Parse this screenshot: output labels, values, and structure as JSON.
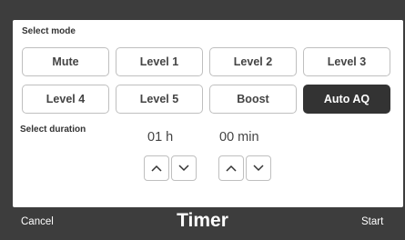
{
  "mode": {
    "label": "Select mode",
    "buttons": [
      "Mute",
      "Level 1",
      "Level 2",
      "Level 3",
      "Level 4",
      "Level 5",
      "Boost",
      "Auto AQ"
    ],
    "selected": "Auto AQ"
  },
  "duration": {
    "label": "Select duration",
    "hours": "01 h",
    "minutes": "00 min"
  },
  "bar": {
    "cancel": "Cancel",
    "title": "Timer",
    "start": "Start"
  },
  "icons": {
    "up": "chevron-up-icon",
    "down": "chevron-down-icon"
  },
  "colors": {
    "selected_bg": "#333333",
    "bar_bg": "#3d3d3d"
  }
}
